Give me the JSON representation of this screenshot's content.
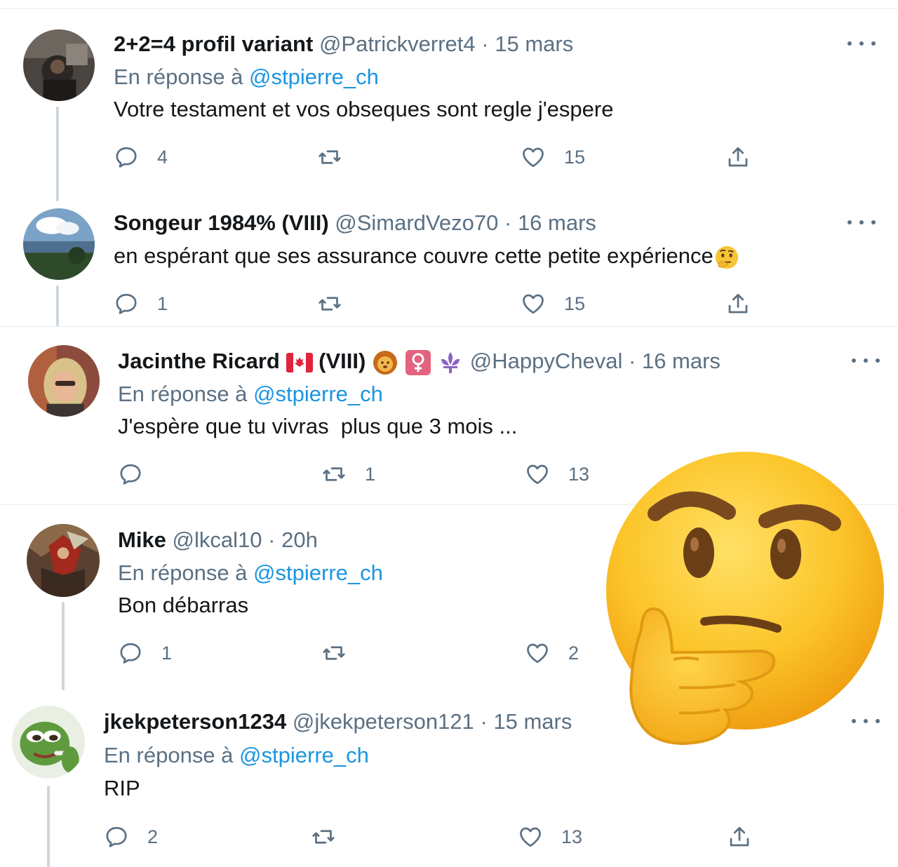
{
  "tweets": [
    {
      "name": "2+2=4 profil variant",
      "handle": "@Patrickverret4",
      "sep": "·",
      "date": "15 mars",
      "reply_prefix": "En réponse à",
      "reply_to": "@stpierre_ch",
      "text": "Votre testament et vos obseques sont regle j'espere",
      "replies": "4",
      "retweets": "",
      "likes": "15"
    },
    {
      "name": "Songeur 1984% (VIII)",
      "handle": "@SimardVezo70",
      "sep": "·",
      "date": "16 mars",
      "text": "en espérant que ses assurance couvre cette petite expérience",
      "text_emoji": "thinking-face",
      "replies": "1",
      "retweets": "",
      "likes": "15"
    },
    {
      "name": "Jacinthe Ricard",
      "name_suffix": "(VIII)",
      "name_emojis": [
        "canada-flag",
        "lion-face",
        "female-sign",
        "fleur-de-lis"
      ],
      "handle": "@HappyCheval",
      "sep": "·",
      "date": "16 mars",
      "reply_prefix": "En réponse à",
      "reply_to": "@stpierre_ch",
      "text": "J'espère que tu vivras  plus que 3 mois ...",
      "replies": "",
      "retweets": "1",
      "likes": "13"
    },
    {
      "name": "Mike",
      "handle": "@lkcal10",
      "sep": "·",
      "date": "20h",
      "reply_prefix": "En réponse à",
      "reply_to": "@stpierre_ch",
      "text": "Bon débarras",
      "replies": "1",
      "retweets": "",
      "likes": "2"
    },
    {
      "name": "jkekpeterson1234",
      "handle": "@jkekpeterson121",
      "sep": "·",
      "date": "15 mars",
      "reply_prefix": "En réponse à",
      "reply_to": "@stpierre_ch",
      "text": "RIP",
      "replies": "2",
      "retweets": "",
      "likes": "13"
    }
  ],
  "overlay": {
    "emoji": "thinking-face"
  },
  "colors": {
    "link": "#1b95e0",
    "secondary": "#5b7083",
    "thread": "#ccd6dd",
    "border": "#e6ecf0"
  }
}
